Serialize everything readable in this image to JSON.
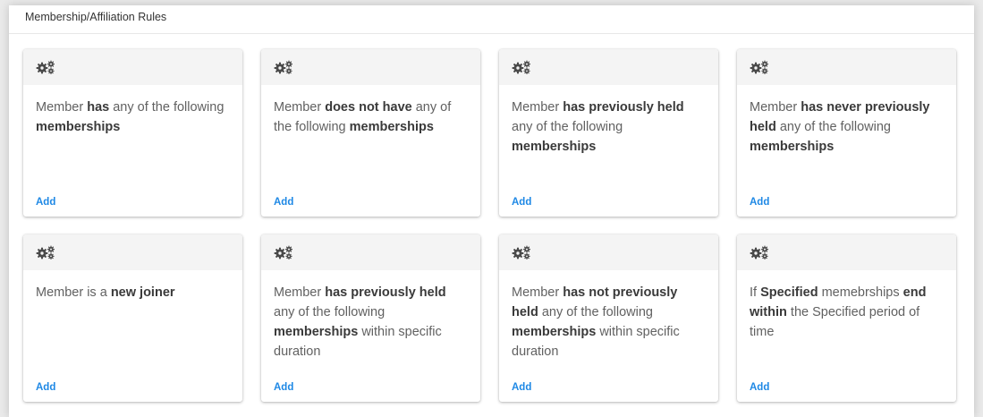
{
  "panel": {
    "title": "Membership/Affiliation Rules"
  },
  "cards": [
    {
      "icon": "gears-icon",
      "add_label": "Add",
      "segments": [
        {
          "t": "Member ",
          "b": false
        },
        {
          "t": "has",
          "b": true
        },
        {
          "t": " any of the following ",
          "b": false
        },
        {
          "t": "memberships",
          "b": true
        }
      ]
    },
    {
      "icon": "gears-icon",
      "add_label": "Add",
      "segments": [
        {
          "t": "Member ",
          "b": false
        },
        {
          "t": "does not have",
          "b": true
        },
        {
          "t": " any of the following ",
          "b": false
        },
        {
          "t": "memberships",
          "b": true
        }
      ]
    },
    {
      "icon": "gears-icon",
      "add_label": "Add",
      "segments": [
        {
          "t": "Member ",
          "b": false
        },
        {
          "t": "has previously held",
          "b": true
        },
        {
          "t": " any of the following ",
          "b": false
        },
        {
          "t": "memberships",
          "b": true
        }
      ]
    },
    {
      "icon": "gears-icon",
      "add_label": "Add",
      "segments": [
        {
          "t": "Member ",
          "b": false
        },
        {
          "t": "has never previously held",
          "b": true
        },
        {
          "t": " any of the following ",
          "b": false
        },
        {
          "t": "memberships",
          "b": true
        }
      ]
    },
    {
      "icon": "gears-icon",
      "add_label": "Add",
      "segments": [
        {
          "t": "Member is a ",
          "b": false
        },
        {
          "t": "new joiner",
          "b": true
        }
      ]
    },
    {
      "icon": "gears-icon",
      "add_label": "Add",
      "segments": [
        {
          "t": "Member ",
          "b": false
        },
        {
          "t": "has previously held",
          "b": true
        },
        {
          "t": " any of the following ",
          "b": false
        },
        {
          "t": "memberships",
          "b": true
        },
        {
          "t": " within specific duration",
          "b": false
        }
      ]
    },
    {
      "icon": "gears-icon",
      "add_label": "Add",
      "segments": [
        {
          "t": "Member ",
          "b": false
        },
        {
          "t": "has not previously held",
          "b": true
        },
        {
          "t": " any of the following ",
          "b": false
        },
        {
          "t": "memberships",
          "b": true
        },
        {
          "t": " within specific duration",
          "b": false
        }
      ]
    },
    {
      "icon": "gears-icon",
      "add_label": "Add",
      "segments": [
        {
          "t": "If ",
          "b": false
        },
        {
          "t": "Specified",
          "b": true
        },
        {
          "t": " memebrships ",
          "b": false
        },
        {
          "t": "end within",
          "b": true
        },
        {
          "t": " the Specified period of time",
          "b": false
        }
      ]
    }
  ]
}
